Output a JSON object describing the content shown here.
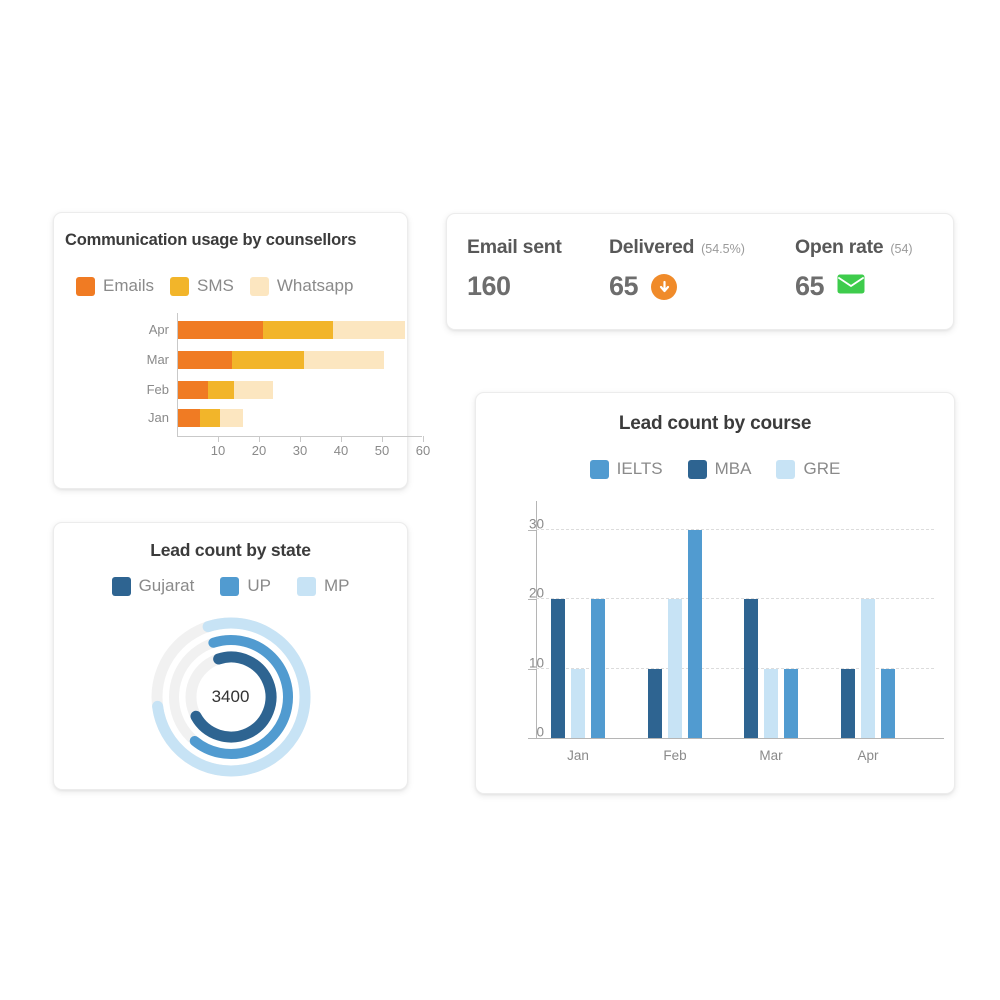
{
  "communication_card": {
    "title": "Communication usage by counsellors",
    "legend": [
      {
        "label": "Emails",
        "color": "#F07B23"
      },
      {
        "label": "SMS",
        "color": "#F2B52A"
      },
      {
        "label": "Whatsapp",
        "color": "#FCE6C0"
      }
    ],
    "chart_data": {
      "type": "bar",
      "orientation": "horizontal",
      "stacked": true,
      "title": "Communication usage by counsellors",
      "xlabel": "",
      "ylabel": "",
      "categories": [
        "Apr",
        "Mar",
        "Feb",
        "Jan"
      ],
      "series": [
        {
          "name": "Emails",
          "color": "#F07B23",
          "values": [
            21,
            13.5,
            7.5,
            5.5
          ]
        },
        {
          "name": "SMS",
          "color": "#F2B52A",
          "values": [
            38,
            31,
            14,
            10.5
          ]
        },
        {
          "name": "Whatsapp",
          "color": "#FCE6C0",
          "values": [
            55.5,
            50.5,
            23.5,
            16
          ]
        }
      ],
      "note": "series values are cumulative stack end-points",
      "xticks": [
        10,
        20,
        30,
        40,
        50,
        60
      ],
      "xlim": [
        0,
        68
      ],
      "grid": false,
      "legend_position": "top-left"
    }
  },
  "kpi_card": {
    "metrics": [
      {
        "label": "Email sent",
        "sub": "",
        "value": "160",
        "icon": "",
        "icon_color": ""
      },
      {
        "label": "Delivered",
        "sub": "(54.5%)",
        "value": "65",
        "icon": "arrow-down",
        "icon_color": "#F08B2A"
      },
      {
        "label": "Open rate",
        "sub": "(54)",
        "value": "65",
        "icon": "envelope",
        "icon_color": "#3ECC4C"
      }
    ]
  },
  "state_card": {
    "title": "Lead count by state",
    "center_value": "3400",
    "legend": [
      {
        "label": "Gujarat",
        "color": "#2E6491"
      },
      {
        "label": "UP",
        "color": "#519BD0"
      },
      {
        "label": "MP",
        "color": "#C7E3F5"
      }
    ],
    "chart_data": {
      "type": "pie",
      "subtype": "radial-progress-rings",
      "title": "Lead count by state",
      "center_label": "3400",
      "track_color": "#F1F1F1",
      "rings": [
        {
          "name": "MP",
          "color": "#C7E3F5",
          "ring": "outer",
          "percent": 78
        },
        {
          "name": "UP",
          "color": "#519BD0",
          "ring": "middle",
          "percent": 66
        },
        {
          "name": "Gujarat",
          "color": "#2E6491",
          "ring": "inner",
          "percent": 72
        }
      ],
      "legend_position": "top"
    }
  },
  "course_card": {
    "title": "Lead count by course",
    "legend": [
      {
        "label": "IELTS",
        "color": "#519BD0"
      },
      {
        "label": "MBA",
        "color": "#2E6491"
      },
      {
        "label": "GRE",
        "color": "#C7E3F5"
      }
    ],
    "chart_data": {
      "type": "bar",
      "orientation": "vertical",
      "grouped": true,
      "title": "Lead count by course",
      "xlabel": "",
      "ylabel": "",
      "categories": [
        "Jan",
        "Feb",
        "Mar",
        "Apr"
      ],
      "bar_order": [
        "MBA",
        "GRE",
        "IELTS"
      ],
      "series": [
        {
          "name": "MBA",
          "color": "#2E6491",
          "values": [
            20,
            10,
            20,
            10
          ]
        },
        {
          "name": "GRE",
          "color": "#C7E3F5",
          "values": [
            10,
            20,
            10,
            20
          ]
        },
        {
          "name": "IELTS",
          "color": "#519BD0",
          "values": [
            20,
            30,
            10,
            10
          ]
        }
      ],
      "yticks": [
        0,
        10,
        20,
        30
      ],
      "ylim": [
        0,
        35
      ],
      "grid": true,
      "legend_position": "top"
    }
  }
}
